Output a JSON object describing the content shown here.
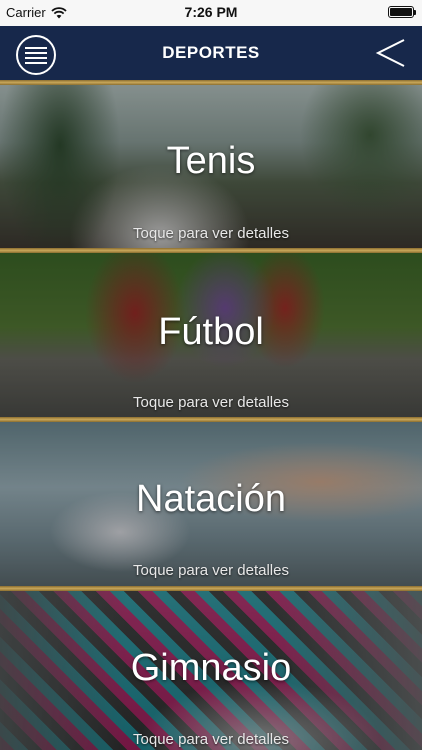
{
  "status_bar": {
    "carrier": "Carrier",
    "time": "7:26 PM"
  },
  "nav": {
    "title": "DEPORTES",
    "menu_icon": "hamburger-menu-icon",
    "back_icon": "chevron-left-icon"
  },
  "colors": {
    "nav_background": "#17284b",
    "divider_gold": "#c9a85a"
  },
  "sports": [
    {
      "name": "Tenis",
      "hint": "Toque para ver detalles"
    },
    {
      "name": "Fútbol",
      "hint": "Toque para ver detalles"
    },
    {
      "name": "Natación",
      "hint": "Toque para ver detalles"
    },
    {
      "name": "Gimnasio",
      "hint": "Toque para ver detalles"
    }
  ]
}
